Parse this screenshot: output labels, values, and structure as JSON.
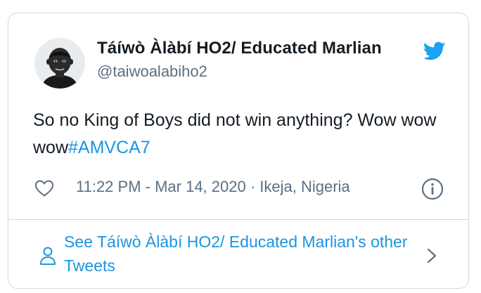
{
  "tweet": {
    "author_name": "Táíwò Àlàbí HO2/ Educated Marlian",
    "author_handle": "@taiwoalabiho2",
    "text_before_hashtag": "So no King of Boys did not win anything? Wow wow wow",
    "hashtag": "#AMVCA7",
    "timestamp_location": "11:22 PM - Mar 14, 2020 · Ikeja, Nigeria"
  },
  "footer": {
    "link_text": "See Táíwò Àlàbí HO2/ Educated Marlian's other Tweets"
  },
  "colors": {
    "brand_blue": "#1da1f2",
    "link_blue": "#1b95e0",
    "text_primary": "#141c24",
    "text_secondary": "#5b7083",
    "border": "#cfd9de"
  },
  "icons": {
    "brand": "twitter-bird-icon",
    "like": "heart-icon",
    "info": "info-icon",
    "profile": "person-icon",
    "chevron": "chevron-right-icon"
  }
}
